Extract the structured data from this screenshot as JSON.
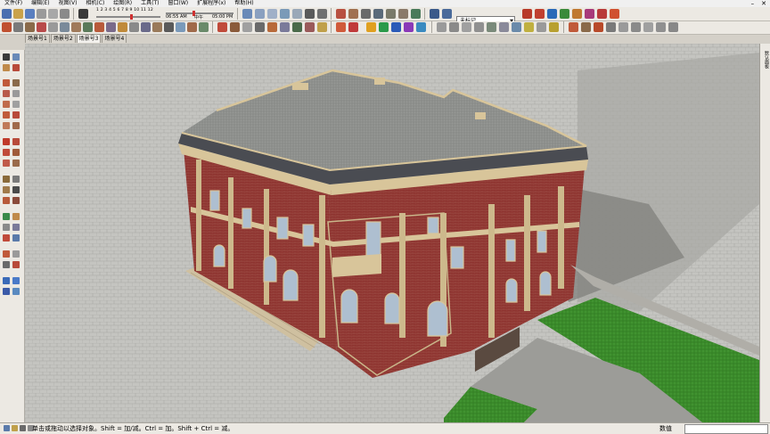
{
  "menus": [
    "文件(F)",
    "编辑(E)",
    "视图(V)",
    "相机(C)",
    "绘图(R)",
    "工具(T)",
    "窗口(W)",
    "扩展程序(x)",
    "帮助(H)"
  ],
  "window_controls": {
    "minimize": "–",
    "close": "✕"
  },
  "shadow": {
    "months": "1 2 3 4 5 6 7 8 9 10 11 12",
    "time_start": "06:55 AM",
    "time_mid": "中午",
    "time_end": "05:00 PM"
  },
  "layer": {
    "current": "未标记"
  },
  "scene_tabs": [
    "场景号1",
    "场景号2",
    "场景号3",
    "场景号4"
  ],
  "right_panel": {
    "label": "默认面板"
  },
  "status": {
    "hint": "单击或拖动以选择对象。Shift = 加/减。Ctrl = 加。Shift + Ctrl = 减。",
    "value_label": "数值",
    "value": ""
  },
  "colors": {
    "brick": "#8e3430",
    "stone": "#d8c59a",
    "roof": "#8f918e",
    "lawn": "#3a8a2a",
    "paving": "#c2c2be"
  }
}
